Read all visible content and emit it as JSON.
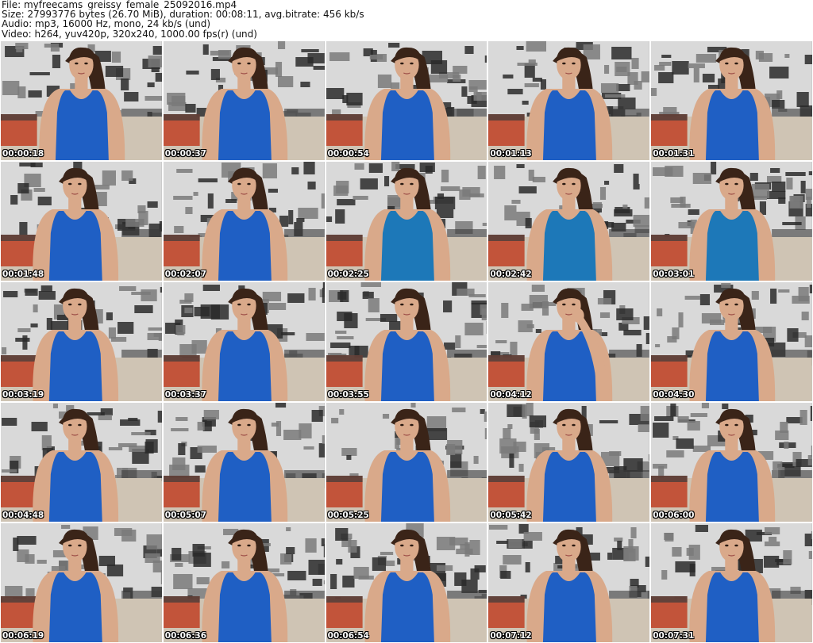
{
  "header": {
    "file_line": "File: myfreecams_greissy_female_25092016.mp4",
    "size_line": "Size: 27993776 bytes (26.70 MiB), duration: 00:08:11, avg.bitrate: 456 kb/s",
    "audio_line": "Audio: mp3, 16000 Hz, mono, 24 kb/s (und)",
    "video_line": "Video: h264, yuv420p, 320x240, 1000.00 fps(r) (und)"
  },
  "colors": {
    "tank_top": "#1f5fc4",
    "tank_top_teal": "#1d78b8",
    "skin": "#d9a98a",
    "hair": "#3a2418",
    "wallpaper_light": "#d9d9d9",
    "wallpaper_dark": "#2a2a2a",
    "sofa_red": "#c0482c",
    "bed_beige": "#cfc4b4"
  },
  "thumbnails": [
    {
      "time": "00:00:18",
      "pose": "center",
      "top": "blue"
    },
    {
      "time": "00:00:37",
      "pose": "center",
      "top": "blue"
    },
    {
      "time": "00:00:54",
      "pose": "center",
      "top": "blue"
    },
    {
      "time": "00:01:13",
      "pose": "center",
      "top": "blue"
    },
    {
      "time": "00:01:31",
      "pose": "center",
      "top": "blue"
    },
    {
      "time": "00:01:48",
      "pose": "left",
      "top": "blue"
    },
    {
      "time": "00:02:07",
      "pose": "center",
      "top": "blue"
    },
    {
      "time": "00:02:25",
      "pose": "center",
      "top": "teal"
    },
    {
      "time": "00:02:42",
      "pose": "center",
      "top": "teal"
    },
    {
      "time": "00:03:01",
      "pose": "center",
      "top": "teal"
    },
    {
      "time": "00:03:19",
      "pose": "left",
      "top": "blue"
    },
    {
      "time": "00:03:37",
      "pose": "center",
      "top": "blue"
    },
    {
      "time": "00:03:55",
      "pose": "center",
      "top": "blue"
    },
    {
      "time": "00:04:12",
      "pose": "hand",
      "top": "blue"
    },
    {
      "time": "00:04:30",
      "pose": "center",
      "top": "blue"
    },
    {
      "time": "00:04:48",
      "pose": "left",
      "top": "blue"
    },
    {
      "time": "00:05:07",
      "pose": "center",
      "top": "blue"
    },
    {
      "time": "00:05:25",
      "pose": "center",
      "top": "blue"
    },
    {
      "time": "00:05:42",
      "pose": "center",
      "top": "blue"
    },
    {
      "time": "00:06:00",
      "pose": "center",
      "top": "blue"
    },
    {
      "time": "00:06:19",
      "pose": "left",
      "top": "blue"
    },
    {
      "time": "00:06:36",
      "pose": "center",
      "top": "blue"
    },
    {
      "time": "00:06:54",
      "pose": "center",
      "top": "blue"
    },
    {
      "time": "00:07:12",
      "pose": "center",
      "top": "blue"
    },
    {
      "time": "00:07:31",
      "pose": "center",
      "top": "blue"
    }
  ]
}
